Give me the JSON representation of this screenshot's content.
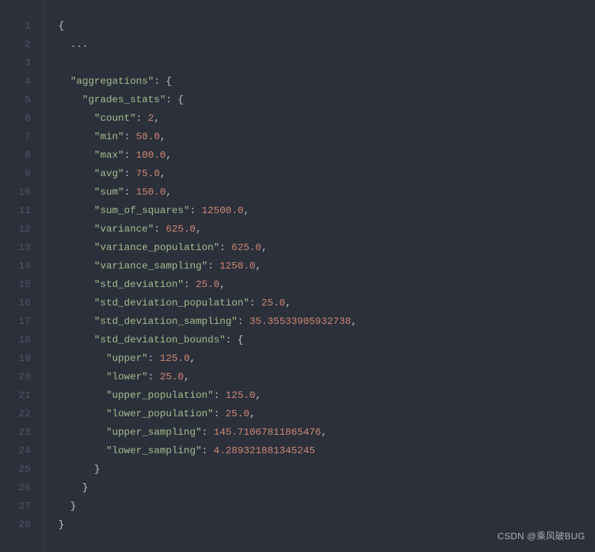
{
  "line_numbers": [
    "1",
    "2",
    "3",
    "4",
    "5",
    "6",
    "7",
    "8",
    "9",
    "10",
    "11",
    "12",
    "13",
    "14",
    "15",
    "16",
    "17",
    "18",
    "19",
    "20",
    "21",
    "22",
    "23",
    "24",
    "25",
    "26",
    "27",
    "28"
  ],
  "lines": {
    "l1": {
      "indent": 0,
      "tokens": [
        {
          "t": "{",
          "c": "punct"
        }
      ]
    },
    "l2": {
      "indent": 1,
      "tokens": [
        {
          "t": "...",
          "c": "punct"
        }
      ]
    },
    "l3": {
      "indent": 0,
      "tokens": []
    },
    "l4": {
      "indent": 1,
      "tokens": [
        {
          "t": "\"aggregations\"",
          "c": "key"
        },
        {
          "t": ": {",
          "c": "punct"
        }
      ]
    },
    "l5": {
      "indent": 2,
      "tokens": [
        {
          "t": "\"grades_stats\"",
          "c": "key"
        },
        {
          "t": ": {",
          "c": "punct"
        }
      ]
    },
    "l6": {
      "indent": 3,
      "tokens": [
        {
          "t": "\"count\"",
          "c": "key"
        },
        {
          "t": ": ",
          "c": "punct"
        },
        {
          "t": "2",
          "c": "num"
        },
        {
          "t": ",",
          "c": "punct"
        }
      ]
    },
    "l7": {
      "indent": 3,
      "tokens": [
        {
          "t": "\"min\"",
          "c": "key"
        },
        {
          "t": ": ",
          "c": "punct"
        },
        {
          "t": "50.0",
          "c": "num"
        },
        {
          "t": ",",
          "c": "punct"
        }
      ]
    },
    "l8": {
      "indent": 3,
      "tokens": [
        {
          "t": "\"max\"",
          "c": "key"
        },
        {
          "t": ": ",
          "c": "punct"
        },
        {
          "t": "100.0",
          "c": "num"
        },
        {
          "t": ",",
          "c": "punct"
        }
      ]
    },
    "l9": {
      "indent": 3,
      "tokens": [
        {
          "t": "\"avg\"",
          "c": "key"
        },
        {
          "t": ": ",
          "c": "punct"
        },
        {
          "t": "75.0",
          "c": "num"
        },
        {
          "t": ",",
          "c": "punct"
        }
      ]
    },
    "l10": {
      "indent": 3,
      "tokens": [
        {
          "t": "\"sum\"",
          "c": "key"
        },
        {
          "t": ": ",
          "c": "punct"
        },
        {
          "t": "150.0",
          "c": "num"
        },
        {
          "t": ",",
          "c": "punct"
        }
      ]
    },
    "l11": {
      "indent": 3,
      "tokens": [
        {
          "t": "\"sum_of_squares\"",
          "c": "key"
        },
        {
          "t": ": ",
          "c": "punct"
        },
        {
          "t": "12500.0",
          "c": "num"
        },
        {
          "t": ",",
          "c": "punct"
        }
      ]
    },
    "l12": {
      "indent": 3,
      "tokens": [
        {
          "t": "\"variance\"",
          "c": "key"
        },
        {
          "t": ": ",
          "c": "punct"
        },
        {
          "t": "625.0",
          "c": "num"
        },
        {
          "t": ",",
          "c": "punct"
        }
      ]
    },
    "l13": {
      "indent": 3,
      "tokens": [
        {
          "t": "\"variance_population\"",
          "c": "key"
        },
        {
          "t": ": ",
          "c": "punct"
        },
        {
          "t": "625.0",
          "c": "num"
        },
        {
          "t": ",",
          "c": "punct"
        }
      ]
    },
    "l14": {
      "indent": 3,
      "tokens": [
        {
          "t": "\"variance_sampling\"",
          "c": "key"
        },
        {
          "t": ": ",
          "c": "punct"
        },
        {
          "t": "1250.0",
          "c": "num"
        },
        {
          "t": ",",
          "c": "punct"
        }
      ]
    },
    "l15": {
      "indent": 3,
      "tokens": [
        {
          "t": "\"std_deviation\"",
          "c": "key"
        },
        {
          "t": ": ",
          "c": "punct"
        },
        {
          "t": "25.0",
          "c": "num"
        },
        {
          "t": ",",
          "c": "punct"
        }
      ]
    },
    "l16": {
      "indent": 3,
      "tokens": [
        {
          "t": "\"std_deviation_population\"",
          "c": "key"
        },
        {
          "t": ": ",
          "c": "punct"
        },
        {
          "t": "25.0",
          "c": "num"
        },
        {
          "t": ",",
          "c": "punct"
        }
      ]
    },
    "l17": {
      "indent": 3,
      "tokens": [
        {
          "t": "\"std_deviation_sampling\"",
          "c": "key"
        },
        {
          "t": ": ",
          "c": "punct"
        },
        {
          "t": "35.35533905932738",
          "c": "num"
        },
        {
          "t": ",",
          "c": "punct"
        }
      ]
    },
    "l18": {
      "indent": 3,
      "tokens": [
        {
          "t": "\"std_deviation_bounds\"",
          "c": "key"
        },
        {
          "t": ": {",
          "c": "punct"
        }
      ]
    },
    "l19": {
      "indent": 4,
      "tokens": [
        {
          "t": "\"upper\"",
          "c": "key"
        },
        {
          "t": ": ",
          "c": "punct"
        },
        {
          "t": "125.0",
          "c": "num"
        },
        {
          "t": ",",
          "c": "punct"
        }
      ]
    },
    "l20": {
      "indent": 4,
      "tokens": [
        {
          "t": "\"lower\"",
          "c": "key"
        },
        {
          "t": ": ",
          "c": "punct"
        },
        {
          "t": "25.0",
          "c": "num"
        },
        {
          "t": ",",
          "c": "punct"
        }
      ]
    },
    "l21": {
      "indent": 4,
      "tokens": [
        {
          "t": "\"upper_population\"",
          "c": "key"
        },
        {
          "t": ": ",
          "c": "punct"
        },
        {
          "t": "125.0",
          "c": "num"
        },
        {
          "t": ",",
          "c": "punct"
        }
      ]
    },
    "l22": {
      "indent": 4,
      "tokens": [
        {
          "t": "\"lower_population\"",
          "c": "key"
        },
        {
          "t": ": ",
          "c": "punct"
        },
        {
          "t": "25.0",
          "c": "num"
        },
        {
          "t": ",",
          "c": "punct"
        }
      ]
    },
    "l23": {
      "indent": 4,
      "tokens": [
        {
          "t": "\"upper_sampling\"",
          "c": "key"
        },
        {
          "t": ": ",
          "c": "punct"
        },
        {
          "t": "145.71067811865476",
          "c": "num"
        },
        {
          "t": ",",
          "c": "punct"
        }
      ]
    },
    "l24": {
      "indent": 4,
      "tokens": [
        {
          "t": "\"lower_sampling\"",
          "c": "key"
        },
        {
          "t": ": ",
          "c": "punct"
        },
        {
          "t": "4.289321881345245",
          "c": "num"
        }
      ]
    },
    "l25": {
      "indent": 3,
      "tokens": [
        {
          "t": "}",
          "c": "punct"
        }
      ]
    },
    "l26": {
      "indent": 2,
      "tokens": [
        {
          "t": "}",
          "c": "punct"
        }
      ]
    },
    "l27": {
      "indent": 1,
      "tokens": [
        {
          "t": "}",
          "c": "punct"
        }
      ]
    },
    "l28": {
      "indent": 0,
      "tokens": [
        {
          "t": "}",
          "c": "punct"
        }
      ]
    }
  },
  "watermark": "CSDN @乘风破BUG"
}
